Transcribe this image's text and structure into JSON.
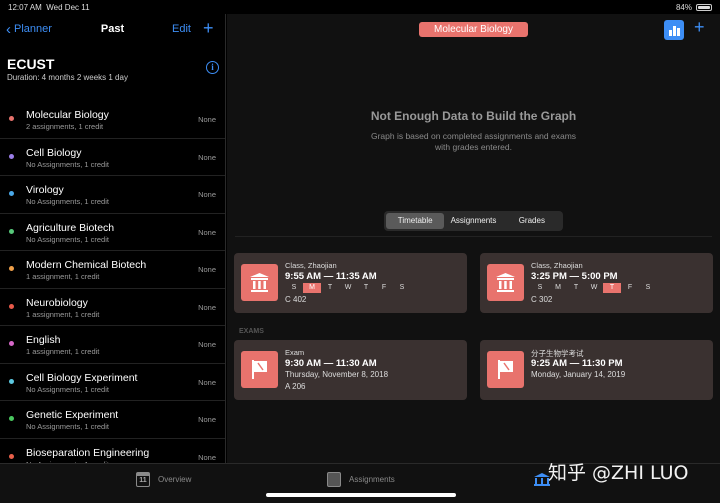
{
  "status_bar": {
    "time": "12:07 AM",
    "date": "Wed Dec 11",
    "battery": "84%",
    "battery_level": 0.84
  },
  "sidebar": {
    "back_label": "Planner",
    "title": "Past",
    "edit_label": "Edit",
    "add_label": "+",
    "school_name": "ECUST",
    "duration": "Duration: 4 months 2 weeks 1 day",
    "courses": [
      {
        "name": "Molecular Biology",
        "sub": "2 assignments, 1 credit",
        "grade": "None",
        "color": "#e8736d"
      },
      {
        "name": "Cell Biology",
        "sub": "No Assignments, 1 credit",
        "grade": "None",
        "color": "#9b7ee8"
      },
      {
        "name": "Virology",
        "sub": "No Assignments, 1 credit",
        "grade": "None",
        "color": "#4aa8e8"
      },
      {
        "name": "Agriculture Biotech",
        "sub": "No Assignments, 1 credit",
        "grade": "None",
        "color": "#57c87a"
      },
      {
        "name": "Modern Chemical Biotech",
        "sub": "1 assignment, 1 credit",
        "grade": "None",
        "color": "#f0a04a"
      },
      {
        "name": "Neurobiology",
        "sub": "1 assignment, 1 credit",
        "grade": "None",
        "color": "#e85a4a"
      },
      {
        "name": "English",
        "sub": "1 assignment, 1 credit",
        "grade": "None",
        "color": "#d667c8"
      },
      {
        "name": "Cell Biology Experiment",
        "sub": "No Assignments, 1 credit",
        "grade": "None",
        "color": "#5cc8e0"
      },
      {
        "name": "Genetic Experiment",
        "sub": "No Assignments, 1 credit",
        "grade": "None",
        "color": "#4ac860"
      },
      {
        "name": "Bioseparation Engineering",
        "sub": "No Assignments, 1 credit",
        "grade": "None",
        "color": "#e8604a"
      }
    ]
  },
  "main": {
    "subject": "Molecular Biology",
    "add_label": "+",
    "empty_title": "Not Enough Data to Build the Graph",
    "empty_desc_1": "Graph is based on completed assignments and exams",
    "empty_desc_2": "with grades entered.",
    "segments": [
      "Timetable",
      "Assignments",
      "Grades"
    ],
    "classes": [
      {
        "type": "Class, Zhaojian",
        "time": "9:55 AM — 11:35 AM",
        "days": [
          "S",
          "M",
          "T",
          "W",
          "T",
          "F",
          "S"
        ],
        "active_day": 1,
        "room": "C 402"
      },
      {
        "type": "Class, Zhaojian",
        "time": "3:25 PM — 5:00 PM",
        "days": [
          "S",
          "M",
          "T",
          "W",
          "T",
          "F",
          "S"
        ],
        "active_day": 4,
        "room": "C 302"
      }
    ],
    "exams_label": "EXAMS",
    "exams": [
      {
        "type": "Exam",
        "time": "9:30 AM — 11:30 AM",
        "date": "Thursday, November 8, 2018",
        "room": "A 206"
      },
      {
        "type": "分子生物学考试",
        "time": "9:25 AM — 11:30 PM",
        "date": "Monday, January 14, 2019",
        "room": ""
      }
    ]
  },
  "tabbar": {
    "overview": "Overview",
    "calendar_day": "11",
    "assignments": "Assignments"
  },
  "watermark": "知乎 @ZHI LUO"
}
